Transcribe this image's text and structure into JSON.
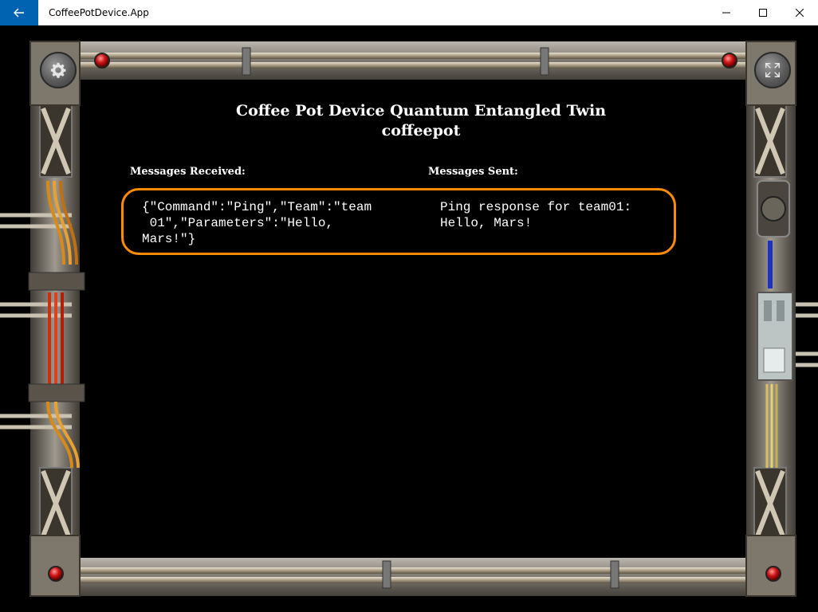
{
  "window": {
    "title": "CoffeePotDevice.App"
  },
  "header": {
    "title_line1": "Coffee Pot Device Quantum Entangled Twin",
    "title_line2": "coffeepot"
  },
  "messages": {
    "received_label": "Messages Received:",
    "sent_label": "Messages Sent:",
    "received_text": "{\"Command\":\"Ping\",\"Team\":\"team\n 01\",\"Parameters\":\"Hello,\nMars!\"}",
    "sent_text": "Ping response for team01: Hello, Mars!"
  },
  "colors": {
    "accent": "#ff8c00",
    "titlebar_back": "#0063b1",
    "background": "#000000"
  },
  "icons": {
    "back": "back-arrow-icon",
    "settings": "gear-icon",
    "fullscreen": "fullscreen-icon"
  }
}
